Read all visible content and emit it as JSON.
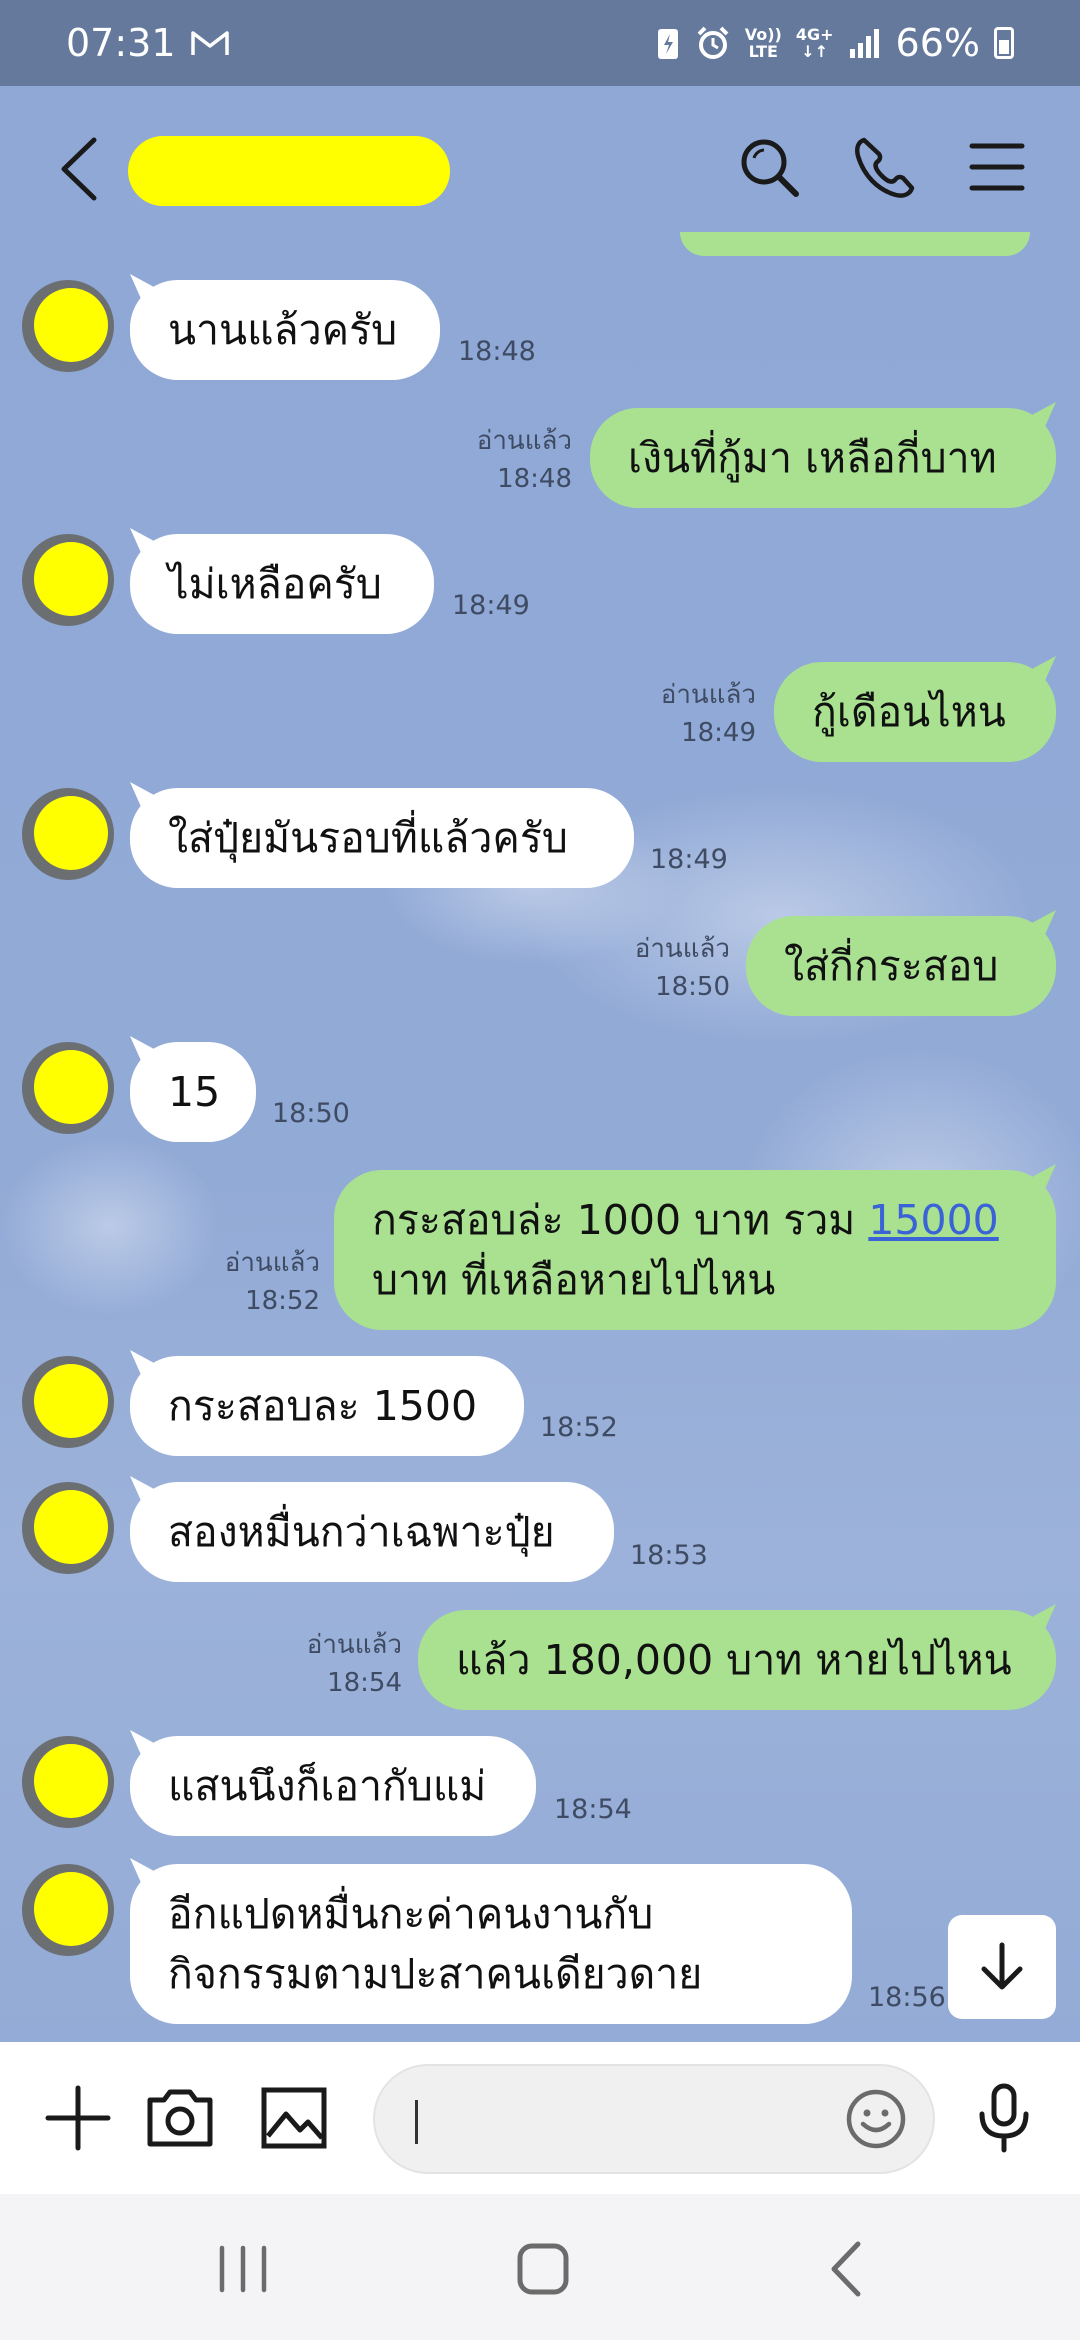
{
  "status_bar": {
    "time": "07:31",
    "gmail_icon": "gmail-icon",
    "volte_top": "Vo))",
    "volte_bottom": "LTE",
    "network": "4G+",
    "battery": "66%"
  },
  "header": {
    "contact_name": "",
    "icons": [
      "back-icon",
      "search-icon",
      "phone-icon",
      "menu-icon"
    ]
  },
  "messages": [
    {
      "dir": "in",
      "text": "นานแล้วครับ",
      "time": "18:48"
    },
    {
      "dir": "out",
      "text": "เงินที่กู้มา เหลือกี่บาท",
      "read": "อ่านแล้ว",
      "time": "18:48"
    },
    {
      "dir": "in",
      "text": "ไม่เหลือครับ",
      "time": "18:49"
    },
    {
      "dir": "out",
      "text": "กู้เดือนไหน",
      "read": "อ่านแล้ว",
      "time": "18:49"
    },
    {
      "dir": "in",
      "text": "ใส่ปุ๋ยมันรอบที่แล้วครับ",
      "time": "18:49"
    },
    {
      "dir": "out",
      "text": "ใส่กี่กระสอบ",
      "read": "อ่านแล้ว",
      "time": "18:50"
    },
    {
      "dir": "in",
      "text": "15",
      "time": "18:50"
    },
    {
      "dir": "out",
      "text_before_link": "กระสอบล่ะ 1000 บาท รวม ",
      "link": "15000",
      "text_line2": "บาท ที่เหลือหายไปไหน",
      "read": "อ่านแล้ว",
      "time": "18:52"
    },
    {
      "dir": "in",
      "text": "กระสอบละ 1500",
      "time": "18:52"
    },
    {
      "dir": "in",
      "text": "สองหมื่นกว่าเฉพาะปุ๋ย",
      "time": "18:53"
    },
    {
      "dir": "out",
      "text": "แล้ว 180,000 บาท หายไปไหน",
      "read": "อ่านแล้ว",
      "time": "18:54"
    },
    {
      "dir": "in",
      "text": "แสนนึงก็เอากับแม่",
      "time": "18:54"
    },
    {
      "dir": "in",
      "line1": "อีกแปดหมื่นกะค่าคนงานกับ",
      "line2": "กิจกรรมตามปะสาคนเดียวดาย",
      "time": "18:56"
    }
  ],
  "input_bar": {
    "placeholder": "",
    "icons": [
      "plus-icon",
      "camera-icon",
      "image-icon",
      "emoji-icon",
      "mic-icon"
    ]
  },
  "colors": {
    "status_bar": "#64799c",
    "chat_bg": "#8ea7d4",
    "incoming_bubble": "#ffffff",
    "outgoing_bubble": "#a9e191",
    "link": "#3a63d8",
    "redaction": "#ffff00"
  }
}
